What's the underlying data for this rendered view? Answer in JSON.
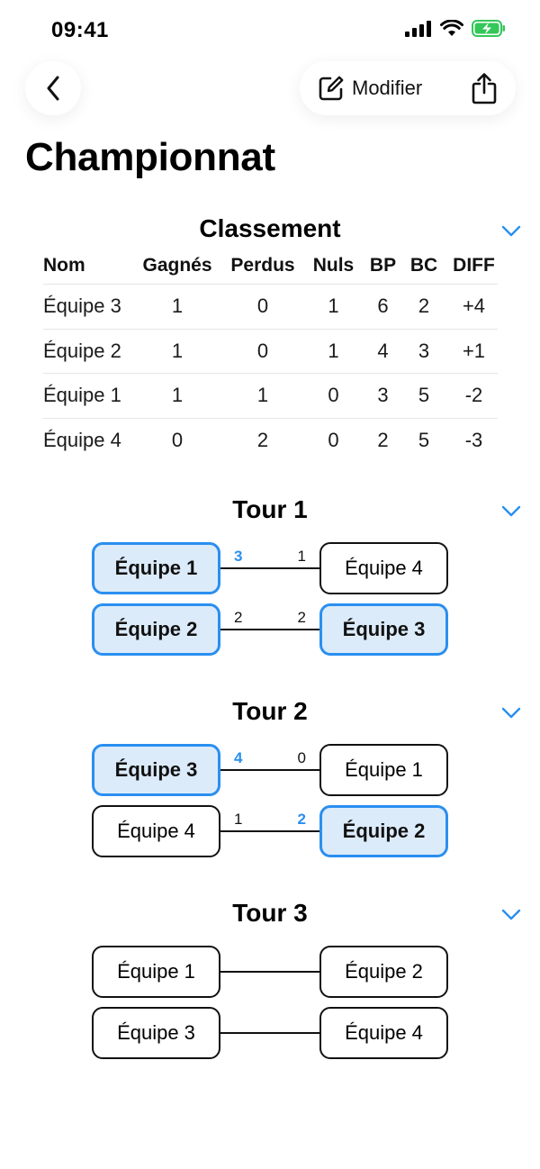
{
  "status": {
    "time": "09:41"
  },
  "nav": {
    "edit_label": "Modifier"
  },
  "page": {
    "title": "Championnat"
  },
  "standings": {
    "title": "Classement",
    "headers": [
      "Nom",
      "Gagnés",
      "Perdus",
      "Nuls",
      "BP",
      "BC",
      "DIFF"
    ],
    "rows": [
      [
        "Équipe 3",
        "1",
        "0",
        "1",
        "6",
        "2",
        "+4"
      ],
      [
        "Équipe 2",
        "1",
        "0",
        "1",
        "4",
        "3",
        "+1"
      ],
      [
        "Équipe 1",
        "1",
        "1",
        "0",
        "3",
        "5",
        "-2"
      ],
      [
        "Équipe 4",
        "0",
        "2",
        "0",
        "2",
        "5",
        "-3"
      ]
    ]
  },
  "rounds": [
    {
      "title": "Tour 1",
      "matches": [
        {
          "home": "Équipe 1",
          "away": "Équipe 4",
          "home_score": "3",
          "away_score": "1",
          "winner": "home"
        },
        {
          "home": "Équipe 2",
          "away": "Équipe 3",
          "home_score": "2",
          "away_score": "2",
          "winner": "both"
        }
      ]
    },
    {
      "title": "Tour 2",
      "matches": [
        {
          "home": "Équipe 3",
          "away": "Équipe 1",
          "home_score": "4",
          "away_score": "0",
          "winner": "home"
        },
        {
          "home": "Équipe 4",
          "away": "Équipe 2",
          "home_score": "1",
          "away_score": "2",
          "winner": "away"
        }
      ]
    },
    {
      "title": "Tour 3",
      "matches": [
        {
          "home": "Équipe 1",
          "away": "Équipe 2",
          "home_score": "",
          "away_score": "",
          "winner": "none"
        },
        {
          "home": "Équipe 3",
          "away": "Équipe 4",
          "home_score": "",
          "away_score": "",
          "winner": "none"
        }
      ]
    }
  ],
  "colors": {
    "accent": "#2a8ff0",
    "winner_fill": "#dcebfa",
    "battery": "#34c759"
  },
  "icons": {
    "back": "chevron-left-icon",
    "edit": "square-pencil-icon",
    "share": "share-icon",
    "collapse": "chevron-down-icon"
  }
}
